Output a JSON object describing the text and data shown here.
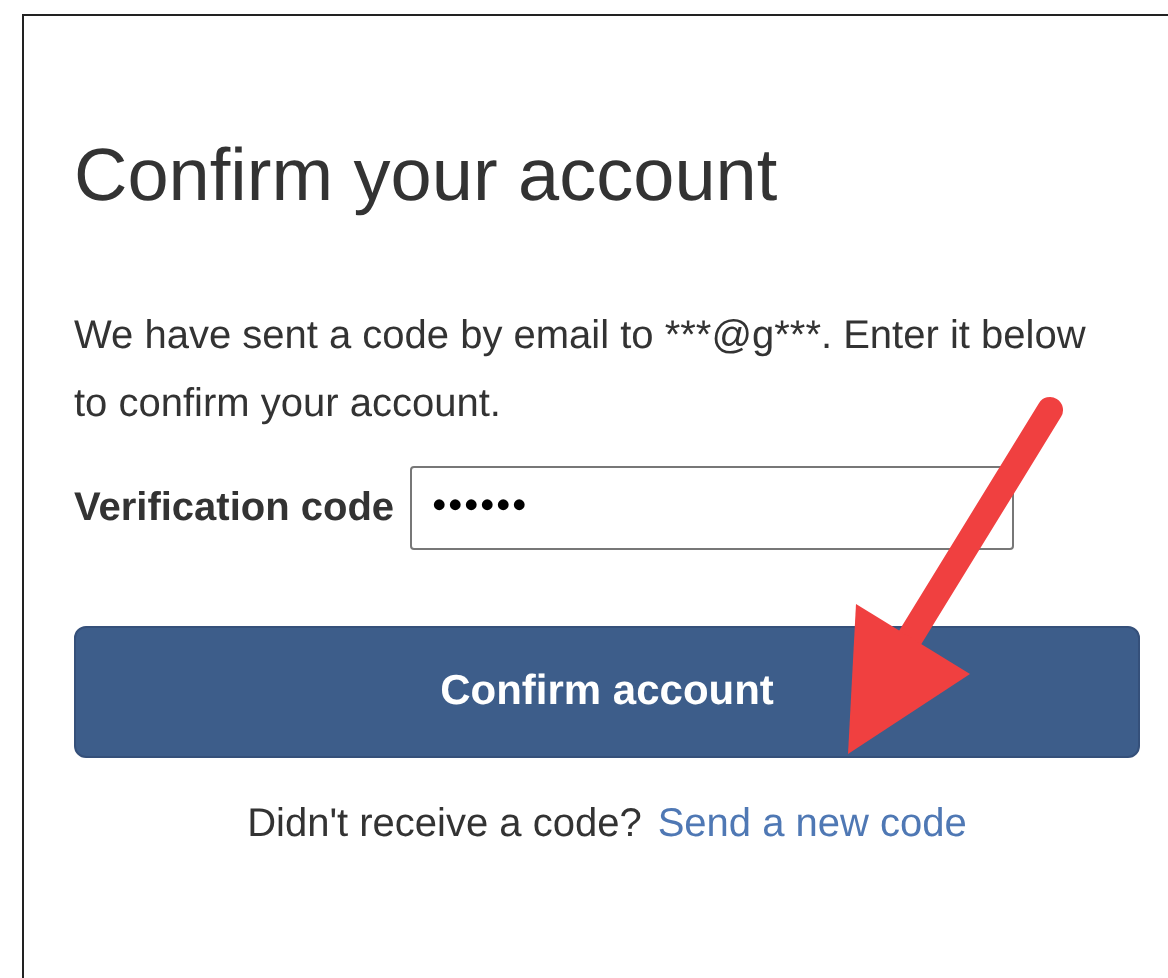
{
  "title": "Confirm your account",
  "message": "We have sent a code by email to ***@g***. Enter it below to confirm your account.",
  "verification_field": {
    "label": "Verification code",
    "value": "••••••"
  },
  "confirm_button": "Confirm account",
  "resend": {
    "prompt": "Didn't receive a code?",
    "link": "Send a new code"
  }
}
